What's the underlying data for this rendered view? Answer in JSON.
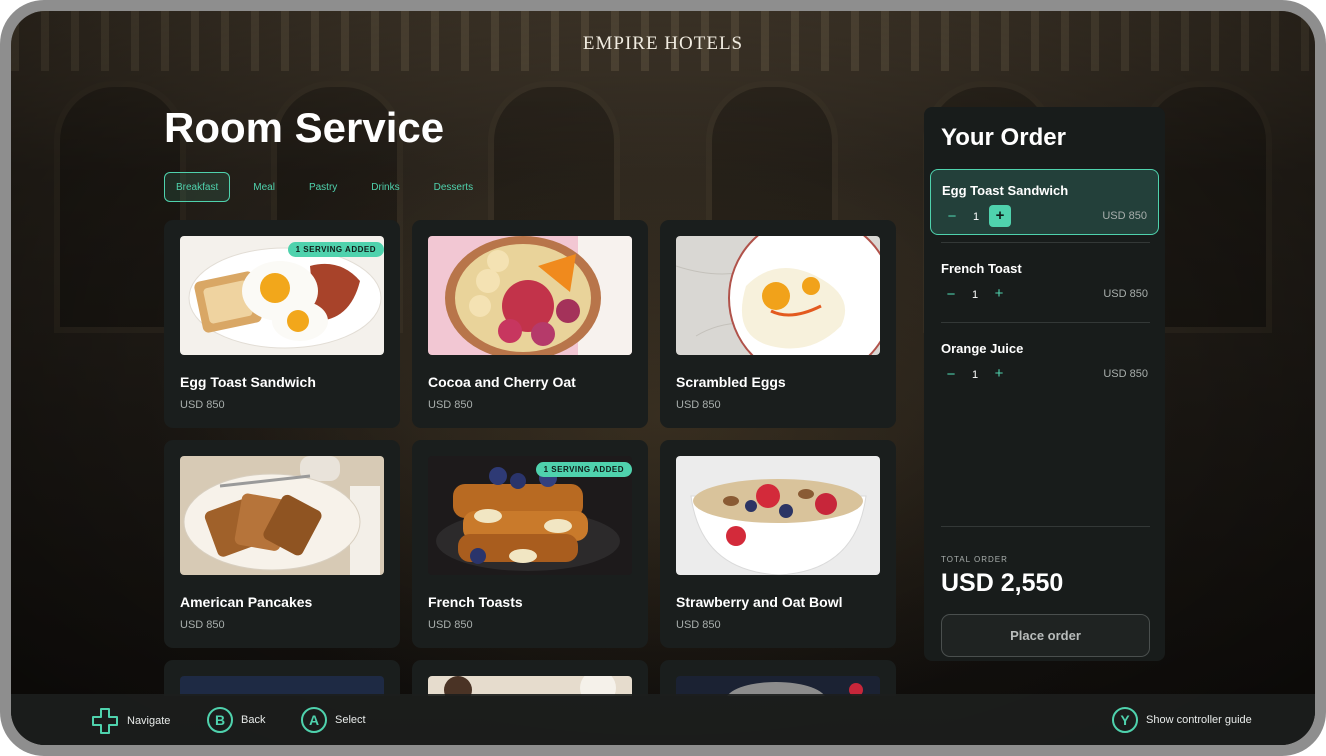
{
  "brand": "EMPIRE HOTELS",
  "title": "Room Service",
  "tabs": [
    {
      "label": "Breakfast",
      "active": true
    },
    {
      "label": "Meal",
      "active": false
    },
    {
      "label": "Pastry",
      "active": false
    },
    {
      "label": "Drinks",
      "active": false
    },
    {
      "label": "Desserts",
      "active": false
    }
  ],
  "menu": {
    "items": [
      {
        "name": "Egg Toast Sandwich",
        "price": "USD 850",
        "badge": "1 SERVING ADDED",
        "image": "egg-toast-image"
      },
      {
        "name": "Cocoa and Cherry Oat",
        "price": "USD 850",
        "badge": "",
        "image": "oat-bowl-image"
      },
      {
        "name": "Scrambled Eggs",
        "price": "USD 850",
        "badge": "",
        "image": "scrambled-eggs-image"
      },
      {
        "name": "American Pancakes",
        "price": "USD 850",
        "badge": "",
        "image": "pancakes-image"
      },
      {
        "name": "French Toasts",
        "price": "USD 850",
        "badge": "1 SERVING ADDED",
        "image": "french-toast-image"
      },
      {
        "name": "Strawberry and Oat Bowl",
        "price": "USD 850",
        "badge": "",
        "image": "strawberry-oat-image"
      }
    ]
  },
  "order": {
    "title": "Your Order",
    "items": [
      {
        "name": "Egg Toast Sandwich",
        "qty": "1",
        "price": "USD 850",
        "selected": true
      },
      {
        "name": "French Toast",
        "qty": "1",
        "price": "USD 850",
        "selected": false
      },
      {
        "name": "Orange Juice",
        "qty": "1",
        "price": "USD 850",
        "selected": false
      }
    ],
    "minus": "−",
    "plus": "+",
    "total_label": "TOTAL ORDER",
    "total": "USD 2,550",
    "place_label": "Place order"
  },
  "footer": {
    "navigate": "Navigate",
    "back_key": "B",
    "back": "Back",
    "select_key": "A",
    "select": "Select",
    "guide_key": "Y",
    "guide": "Show controller guide"
  },
  "colors": {
    "accent": "#4fd2ad",
    "card": "#1a1e1d",
    "panel": "#181c1b"
  }
}
